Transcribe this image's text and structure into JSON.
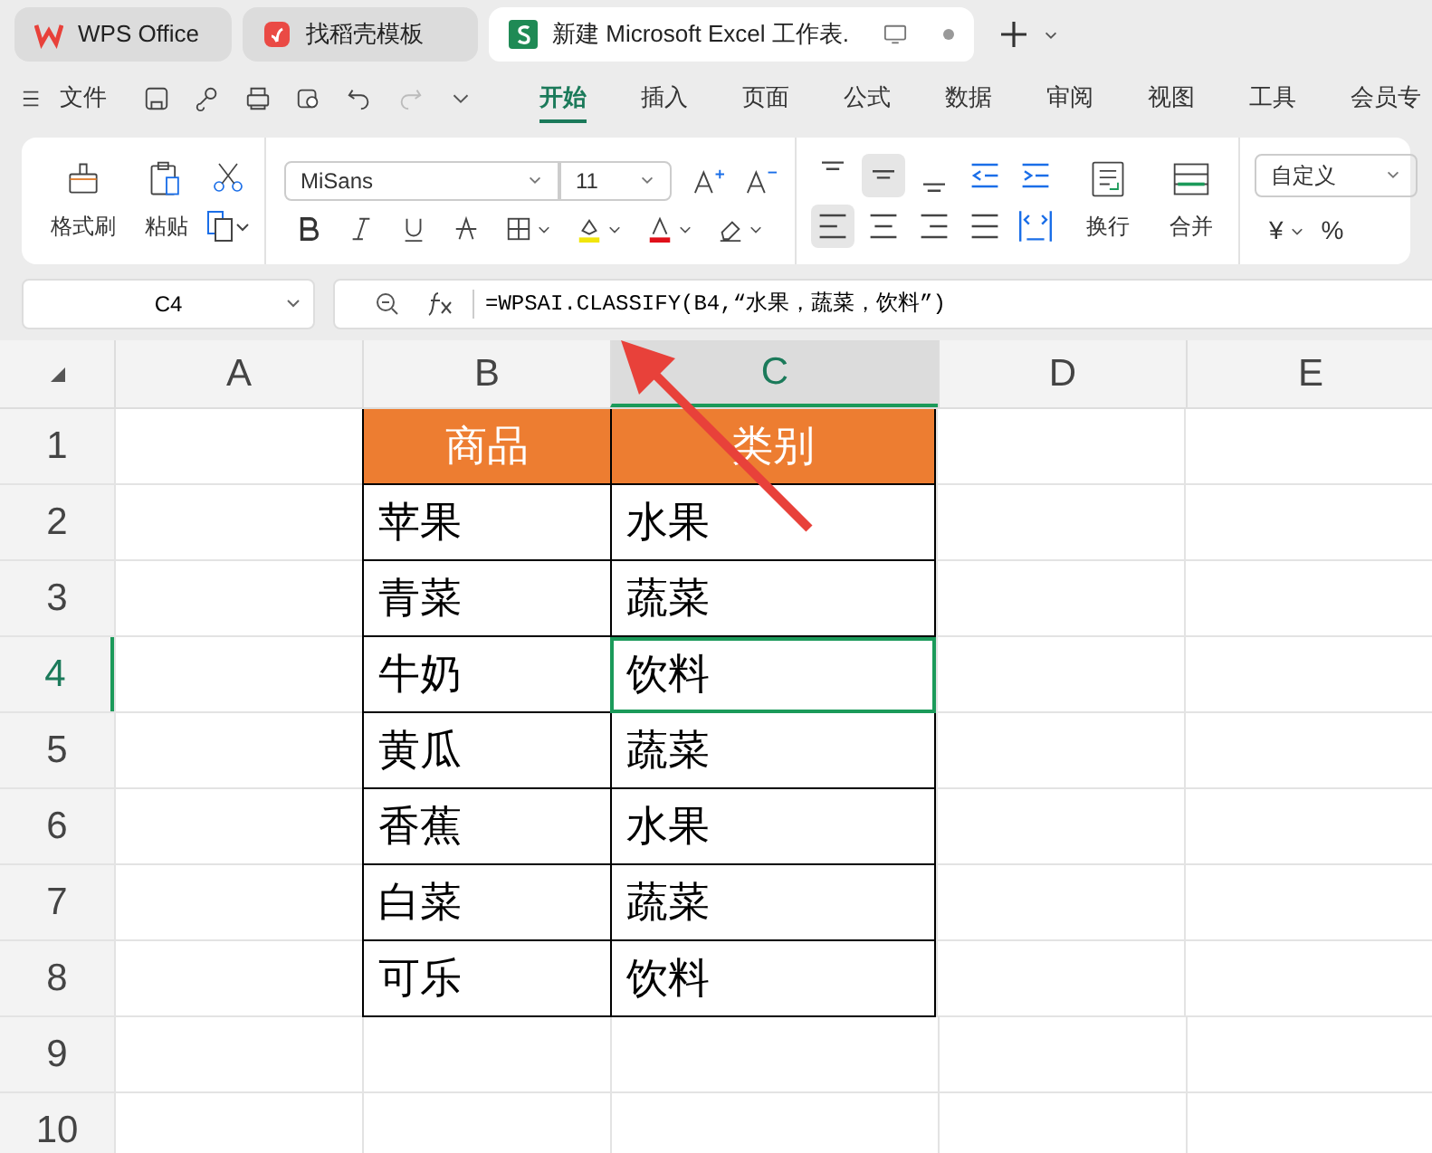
{
  "tabs": [
    {
      "kind": "wps",
      "label": "WPS Office",
      "selected": false
    },
    {
      "kind": "docer",
      "label": "找稻壳模板",
      "selected": false
    },
    {
      "kind": "sheet",
      "label": "新建 Microsoft Excel 工作表.",
      "selected": true
    }
  ],
  "menu": [
    {
      "label": "文件",
      "selected": false
    },
    {
      "label": "开始",
      "selected": true
    },
    {
      "label": "插入",
      "selected": false
    },
    {
      "label": "页面",
      "selected": false
    },
    {
      "label": "公式",
      "selected": false
    },
    {
      "label": "数据",
      "selected": false
    },
    {
      "label": "审阅",
      "selected": false
    },
    {
      "label": "视图",
      "selected": false
    },
    {
      "label": "工具",
      "selected": false
    },
    {
      "label": "会员专",
      "selected": false
    }
  ],
  "ribbon": {
    "format_painter": "格式刷",
    "paste": "粘贴",
    "font_name": "MiSans",
    "font_size": "11",
    "wrap": "换行",
    "merge": "合并",
    "number_format": "自定义",
    "currency": "¥",
    "percent": "%",
    "vertical_align": [
      {
        "selected": false
      },
      {
        "selected": true
      },
      {
        "selected": false
      }
    ],
    "horizontal_align": [
      {
        "selected": true
      },
      {
        "selected": false
      },
      {
        "selected": false
      },
      {
        "selected": false
      }
    ]
  },
  "name_box": "C4",
  "formula": "=WPSAI.CLASSIFY(B4,“水果，蔬菜，饮料”)",
  "columns": [
    {
      "label": "A",
      "selected": false
    },
    {
      "label": "B",
      "selected": false
    },
    {
      "label": "C",
      "selected": true
    },
    {
      "label": "D",
      "selected": false
    },
    {
      "label": "E",
      "selected": false
    }
  ],
  "rows": [
    {
      "label": "1",
      "kind": "header",
      "selected": false,
      "cells": [
        {
          "text": "商品",
          "selected": false
        },
        {
          "text": "类别",
          "selected": false
        }
      ]
    },
    {
      "label": "2",
      "kind": "data",
      "selected": false,
      "cells": [
        {
          "text": "苹果",
          "selected": false
        },
        {
          "text": "水果",
          "selected": false
        }
      ]
    },
    {
      "label": "3",
      "kind": "data",
      "selected": false,
      "cells": [
        {
          "text": "青菜",
          "selected": false
        },
        {
          "text": "蔬菜",
          "selected": false
        }
      ]
    },
    {
      "label": "4",
      "kind": "data",
      "selected": true,
      "cells": [
        {
          "text": "牛奶",
          "selected": false
        },
        {
          "text": "饮料",
          "selected": true
        }
      ]
    },
    {
      "label": "5",
      "kind": "data",
      "selected": false,
      "cells": [
        {
          "text": "黄瓜",
          "selected": false
        },
        {
          "text": "蔬菜",
          "selected": false
        }
      ]
    },
    {
      "label": "6",
      "kind": "data",
      "selected": false,
      "cells": [
        {
          "text": "香蕉",
          "selected": false
        },
        {
          "text": "水果",
          "selected": false
        }
      ]
    },
    {
      "label": "7",
      "kind": "data",
      "selected": false,
      "cells": [
        {
          "text": "白菜",
          "selected": false
        },
        {
          "text": "蔬菜",
          "selected": false
        }
      ]
    },
    {
      "label": "8",
      "kind": "data",
      "selected": false,
      "cells": [
        {
          "text": "可乐",
          "selected": false
        },
        {
          "text": "饮料",
          "selected": false
        }
      ]
    },
    {
      "label": "9",
      "kind": "empty",
      "selected": false,
      "cells": []
    },
    {
      "label": "10",
      "kind": "empty",
      "selected": false,
      "cells": []
    }
  ]
}
